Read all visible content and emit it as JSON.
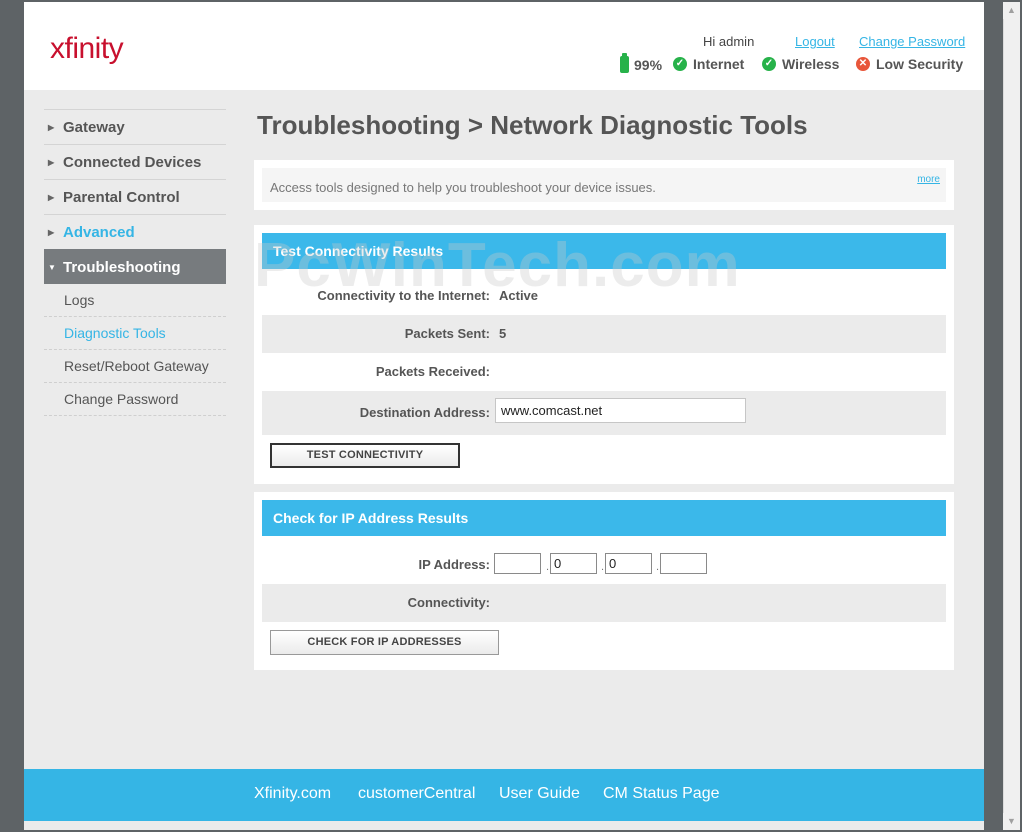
{
  "header": {
    "logo": "xfinity",
    "greeting": "Hi admin",
    "logout_label": "Logout",
    "change_password_label": "Change Password",
    "battery": "99%",
    "status": [
      {
        "label": "Internet",
        "state": "ok"
      },
      {
        "label": "Wireless",
        "state": "ok"
      },
      {
        "label": "Low Security",
        "state": "bad"
      }
    ]
  },
  "sidebar": {
    "items": [
      {
        "label": "Gateway"
      },
      {
        "label": "Connected Devices"
      },
      {
        "label": "Parental Control"
      },
      {
        "label": "Advanced"
      },
      {
        "label": "Troubleshooting"
      }
    ],
    "subitems": [
      {
        "label": "Logs"
      },
      {
        "label": "Diagnostic Tools"
      },
      {
        "label": "Reset/Reboot Gateway"
      },
      {
        "label": "Change Password"
      }
    ]
  },
  "main": {
    "title": "Troubleshooting > Network Diagnostic Tools",
    "info_text": "Access tools designed to help you troubleshoot your device issues.",
    "more_label": "more",
    "connectivity": {
      "section_title": "Test Connectivity Results",
      "internet_label": "Connectivity to the Internet:",
      "internet_value": "Active",
      "sent_label": "Packets Sent:",
      "sent_value": "5",
      "received_label": "Packets Received:",
      "received_value": "",
      "destination_label": "Destination Address:",
      "destination_value": "www.comcast.net",
      "button_label": "TEST  CONNECTIVITY"
    },
    "ip": {
      "section_title": "Check for IP Address Results",
      "ip_label": "IP Address:",
      "octets": [
        "",
        "0",
        "0",
        ""
      ],
      "connectivity_label": "Connectivity:",
      "connectivity_value": "",
      "button_label": "CHECK FOR IP ADDRESSES"
    }
  },
  "watermark": "PcWinTech.com",
  "footer": {
    "links": [
      "Xfinity.com",
      "customerCentral",
      "User Guide",
      "CM Status Page"
    ]
  }
}
